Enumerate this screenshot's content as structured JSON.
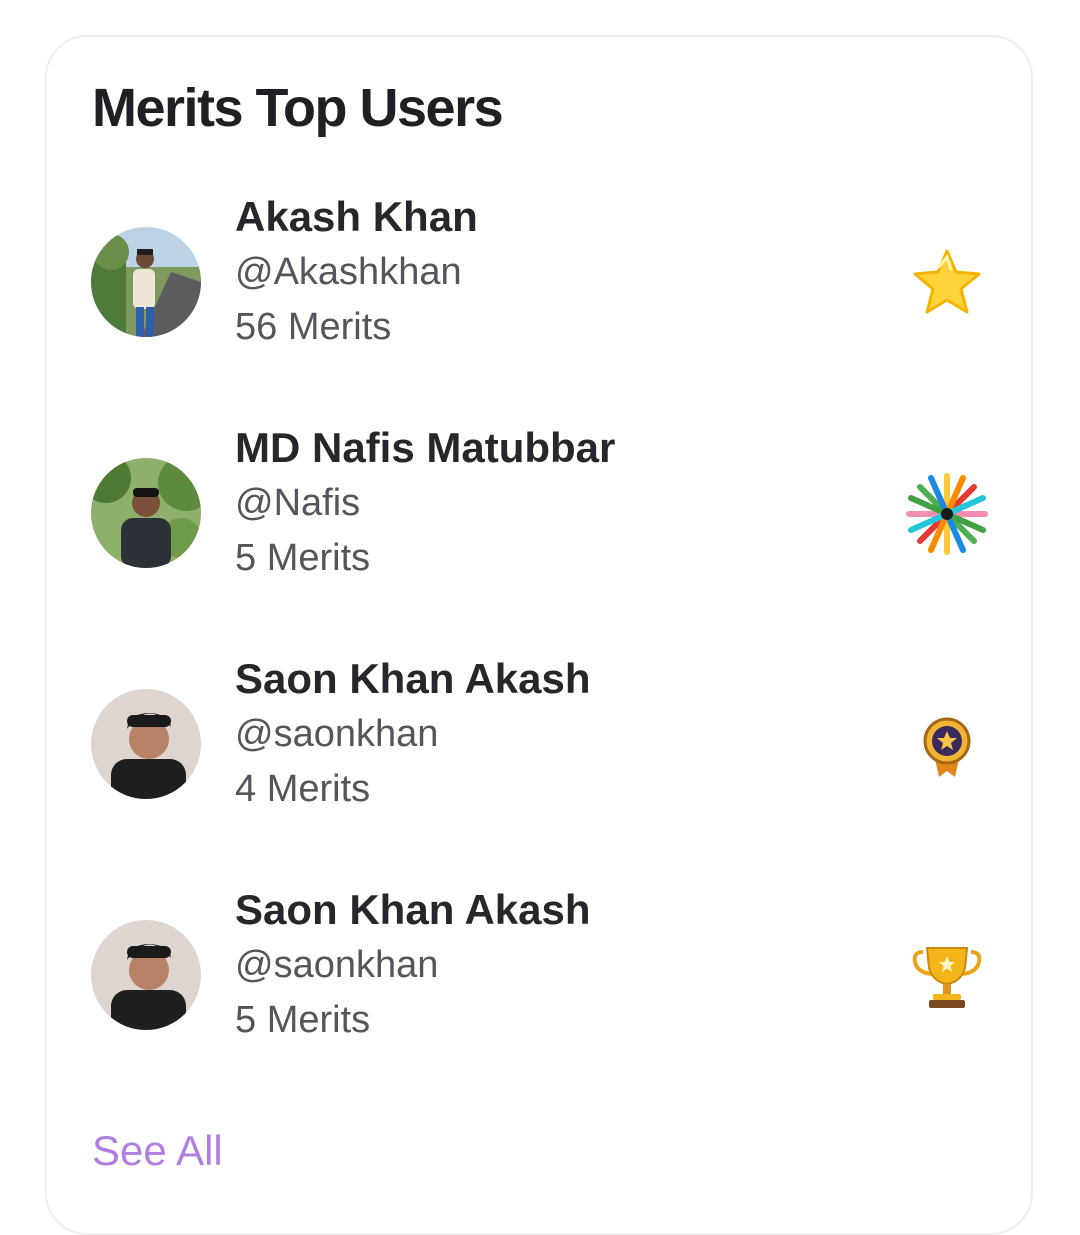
{
  "widget": {
    "title": "Merits Top Users",
    "see_all_label": "See All",
    "accent_color": "#b07fe0"
  },
  "users": [
    {
      "name": "Akash Khan",
      "handle": "@Akashkhan",
      "merits": "56 Merits",
      "badge_icon": "star-icon"
    },
    {
      "name": "MD Nafis Matubbar",
      "handle": "@Nafis",
      "merits": "5 Merits",
      "badge_icon": "starburst-icon"
    },
    {
      "name": "Saon Khan Akash",
      "handle": "@saonkhan",
      "merits": "4 Merits",
      "badge_icon": "medal-icon"
    },
    {
      "name": "Saon Khan Akash",
      "handle": "@saonkhan",
      "merits": "5 Merits",
      "badge_icon": "trophy-icon"
    }
  ]
}
